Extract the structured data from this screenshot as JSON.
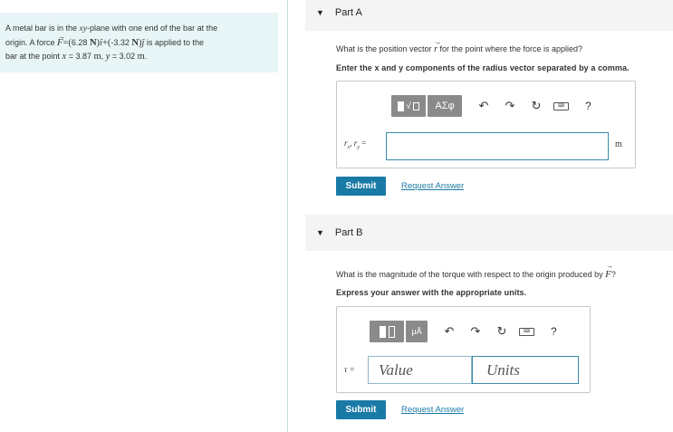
{
  "problem": {
    "text1": "A metal bar is in the ",
    "xy": "xy",
    "text2": "-plane with one end of the bar at the",
    "text3": "origin. A force ",
    "F": "F",
    "eq": "=(",
    "fx": "6.28",
    "n1": "N",
    "paren1": ")",
    "ihat": "î",
    "plus": "+(",
    "fy": "-3.32",
    "n2": "N",
    "paren2": ")",
    "jhat": "ĵ",
    "text4": " is applied to the",
    "text5": "bar at the point ",
    "x": "x",
    "xval": " = 3.87 ",
    "m1": "m",
    "comma": ", ",
    "y": "y",
    "yval": " = 3.02 ",
    "m2": "m",
    "dot": "."
  },
  "partA": {
    "caret": "▼",
    "title": "Part A",
    "question_pre": "What is the position vector ",
    "r": "r",
    "question_post": " for the point where the force is applied?",
    "instruction": "Enter the x and y components of the radius vector separated by a comma.",
    "toolbar_symbols": "ΑΣφ",
    "help": "?",
    "input_label": "rₓ, r_y =",
    "unit": "m",
    "submit": "Submit",
    "request": "Request Answer"
  },
  "partB": {
    "caret": "▼",
    "title": "Part B",
    "question_pre": "What is the magnitude of the torque with respect to the origin produced by ",
    "F": "F",
    "question_post": "?",
    "instruction": "Express your answer with the appropriate units.",
    "toolbar_units": "μÅ",
    "help": "?",
    "input_label": "τ =",
    "value_placeholder": "Value",
    "units_placeholder": "Units",
    "submit": "Submit",
    "request": "Request Answer"
  }
}
